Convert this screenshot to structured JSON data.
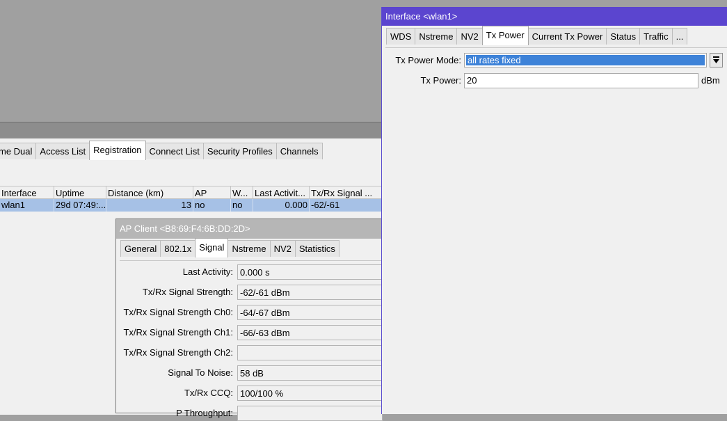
{
  "registration_window": {
    "tabs": [
      "me Dual",
      "Access List",
      "Registration",
      "Connect List",
      "Security Profiles",
      "Channels"
    ],
    "active_tab": "Registration",
    "columns": [
      "Interface",
      "Uptime",
      "Distance (km)",
      "AP",
      "W...",
      "Last Activit...",
      "Tx/Rx Signal ..."
    ],
    "rows": [
      {
        "interface": "wlan1",
        "uptime": "29d 07:49:...",
        "distance": "13",
        "ap": "no",
        "w": "no",
        "last_activity": "0.000",
        "signal": "-62/-61"
      }
    ]
  },
  "ap_client": {
    "title": "AP Client <B8:69:F4:6B:DD:2D>",
    "tabs": [
      "General",
      "802.1x",
      "Signal",
      "Nstreme",
      "NV2",
      "Statistics"
    ],
    "active_tab": "Signal",
    "fields": [
      {
        "label": "Last Activity:",
        "value": "0.000 s"
      },
      {
        "label": "Tx/Rx Signal Strength:",
        "value": "-62/-61 dBm"
      },
      {
        "label": "Tx/Rx Signal Strength Ch0:",
        "value": "-64/-67 dBm"
      },
      {
        "label": "Tx/Rx Signal Strength Ch1:",
        "value": "-66/-63 dBm"
      },
      {
        "label": "Tx/Rx Signal Strength Ch2:",
        "value": ""
      },
      {
        "label": "Signal To Noise:",
        "value": "58 dB"
      },
      {
        "label": "Tx/Rx CCQ:",
        "value": "100/100 %"
      },
      {
        "label": "P Throughput:",
        "value": ""
      }
    ]
  },
  "interface": {
    "title": "Interface <wlan1>",
    "tabs": [
      "WDS",
      "Nstreme",
      "NV2",
      "Tx Power",
      "Current Tx Power",
      "Status",
      "Traffic",
      "..."
    ],
    "active_tab": "Tx Power",
    "tx_power_mode_label": "Tx Power Mode:",
    "tx_power_mode_value": "all rates fixed",
    "tx_power_label": "Tx Power:",
    "tx_power_value": "20",
    "tx_power_unit": "dBm",
    "dropdown_icon": "arrow-down-icon"
  }
}
